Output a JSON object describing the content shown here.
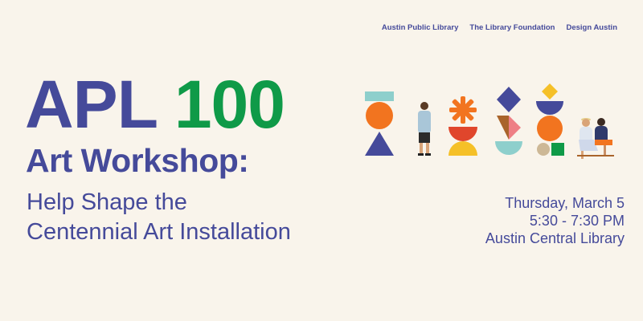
{
  "partners": [
    "Austin Public Library",
    "The Library Foundation",
    "Design Austin"
  ],
  "title": {
    "prefix": "APL",
    "number": "100"
  },
  "subtitle": "Art Workshop:",
  "tagline": [
    "Help Shape the",
    "Centennial Art Installation"
  ],
  "event": {
    "date": "Thursday, March 5",
    "time": "5:30 - 7:30 PM",
    "location": "Austin Central Library"
  },
  "colors": {
    "background": "#f9f4eb",
    "primary": "#454a9a",
    "accent_green": "#0f9a48",
    "orange": "#f2741f",
    "teal": "#8ecfcc",
    "yellow": "#f5c028",
    "red": "#e0462c",
    "pink": "#ee7f85",
    "brown": "#a9642b",
    "tan": "#cdb896"
  }
}
